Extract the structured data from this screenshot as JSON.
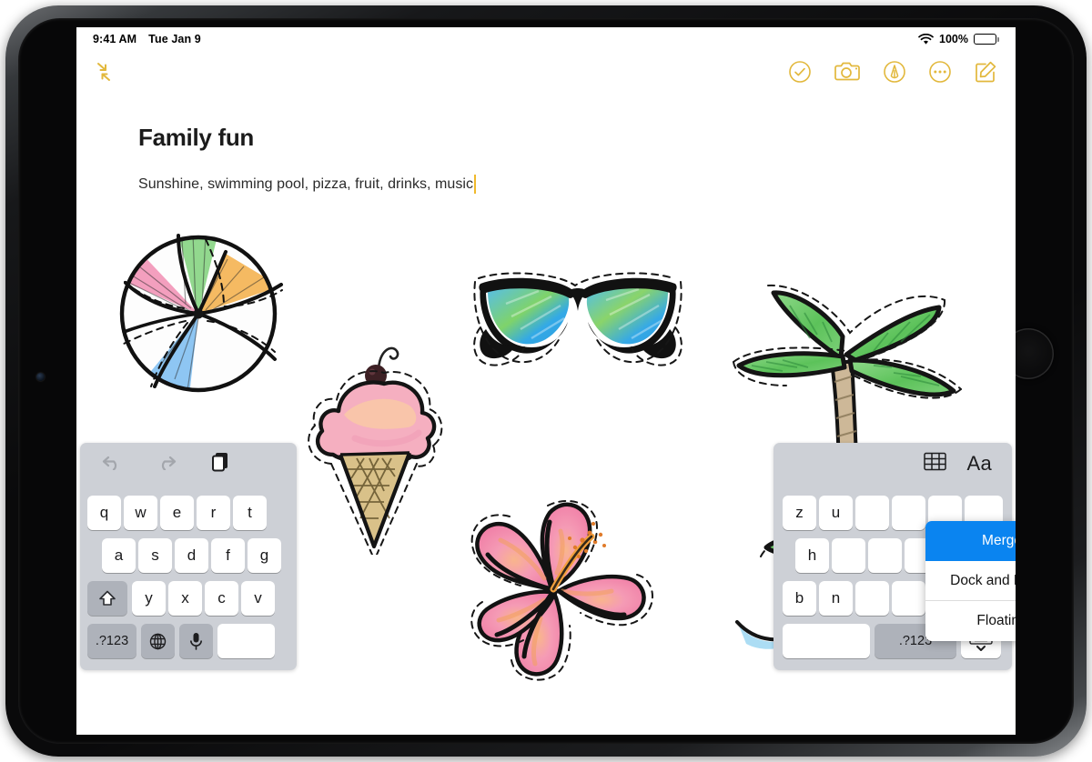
{
  "status_bar": {
    "time": "9:41 AM",
    "date": "Tue Jan 9",
    "battery_percent": "100%",
    "wifi_icon": "wifi-icon",
    "battery_icon": "battery-icon"
  },
  "toolbar": {
    "collapse_icon": "collapse-arrows-icon",
    "actions": [
      {
        "name": "checklist-button",
        "icon": "checkmark-circle-icon"
      },
      {
        "name": "camera-button",
        "icon": "camera-icon"
      },
      {
        "name": "markup-button",
        "icon": "markup-pen-circle-icon"
      },
      {
        "name": "more-button",
        "icon": "ellipsis-circle-icon"
      },
      {
        "name": "compose-button",
        "icon": "compose-square-pencil-icon"
      }
    ],
    "accent_color": "#e2b83c"
  },
  "note": {
    "title": "Family fun",
    "body": "Sunshine, swimming pool, pizza, fruit, drinks, music",
    "caret_color": "#f0b92c",
    "stickers": [
      {
        "name": "beach-ball-sticker",
        "label": "beach ball"
      },
      {
        "name": "ice-cream-cone-sticker",
        "label": "ice cream cone"
      },
      {
        "name": "sunglasses-sticker",
        "label": "sunglasses"
      },
      {
        "name": "hibiscus-flower-sticker",
        "label": "hibiscus flower"
      },
      {
        "name": "palm-tree-sticker",
        "label": "palm tree"
      },
      {
        "name": "small-palm-sticker",
        "label": "small palm plant"
      }
    ]
  },
  "keyboard": {
    "left": {
      "toolbar": [
        {
          "name": "undo-button",
          "icon": "undo-arrow-icon",
          "enabled": false
        },
        {
          "name": "redo-button",
          "icon": "redo-arrow-icon",
          "enabled": false
        },
        {
          "name": "paste-button",
          "icon": "paste-documents-icon",
          "enabled": true
        }
      ],
      "row1": [
        "q",
        "w",
        "e",
        "r",
        "t"
      ],
      "row2": [
        "a",
        "s",
        "d",
        "f",
        "g"
      ],
      "row3": [
        "y",
        "x",
        "c",
        "v"
      ],
      "shift_key": "shift-arrow-icon",
      "numbers_key": ".?123",
      "globe_key": "globe-icon",
      "mic_key": "microphone-icon",
      "space_key": ""
    },
    "right": {
      "toolbar": [
        {
          "name": "table-button",
          "icon": "table-grid-icon"
        },
        {
          "name": "text-format-button",
          "icon": "Aa"
        }
      ],
      "row1": [
        "z",
        "u"
      ],
      "row2": [
        "h"
      ],
      "row3": [
        "b",
        "n"
      ],
      "numbers_key": ".?123",
      "hide_keyboard_key": "hide-keyboard-icon",
      "space_key": ""
    },
    "popup_menu": {
      "items": [
        {
          "label": "Merge",
          "selected": true
        },
        {
          "label": "Dock and Merge",
          "selected": false
        },
        {
          "label": "Floating",
          "selected": false
        }
      ],
      "highlight_color": "#0a84f0"
    }
  }
}
